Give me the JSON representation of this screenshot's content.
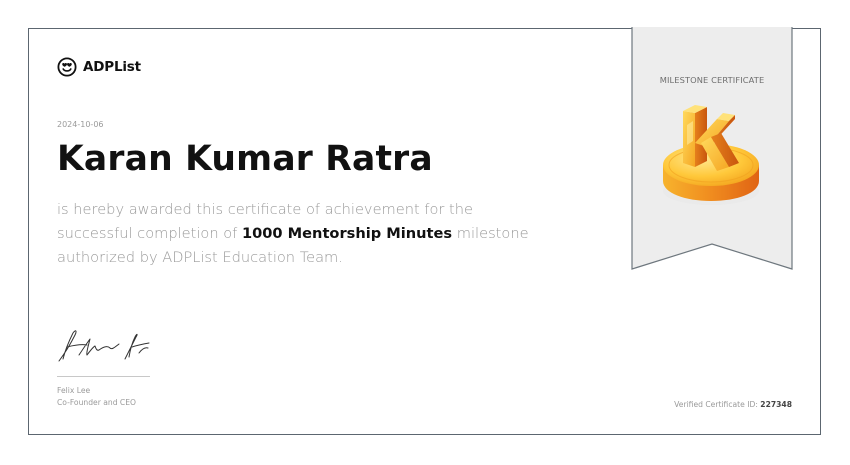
{
  "brand": {
    "name": "ADPList"
  },
  "certificate": {
    "date": "2024-10-06",
    "recipient": "Karan Kumar Ratra",
    "text_before": "is hereby awarded this certificate of achievement for the successful completion of ",
    "milestone": "1000 Mentorship Minutes",
    "text_after": " milestone authorized by ADPList Education Team.",
    "ribbon_label": "MILESTONE CERTIFICATE",
    "id_label": "Verified Certificate ID: ",
    "id_value": "227348"
  },
  "signer": {
    "name": "Felix Lee",
    "role": "Co-Founder and CEO"
  },
  "colors": {
    "border": "#5c6670",
    "muted_text": "#9a9a9a",
    "badge_gold": "#f3a723",
    "badge_orange": "#e8731a"
  },
  "icons": {
    "logo": "smiling-face-heart-eyes-icon",
    "badge": "gold-k-coin-icon",
    "signature": "handwritten-signature"
  }
}
